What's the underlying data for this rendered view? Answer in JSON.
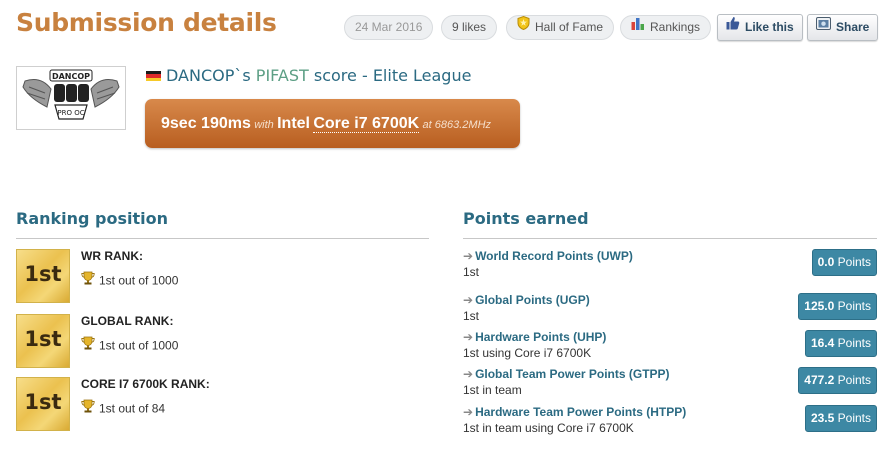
{
  "page": {
    "title": "Submission details"
  },
  "header": {
    "date": "24 Mar 2016",
    "likes": "9 likes",
    "hall_of_fame": "Hall of Fame",
    "rankings": "Rankings",
    "like_this": "Like this",
    "share": "Share"
  },
  "submission": {
    "user": "DANCOP",
    "possessive": "`s ",
    "benchmark": "PIFAST",
    "score_word": " score",
    "league_sep": " - ",
    "league": "Elite League",
    "score_value": "9sec 190ms",
    "with_word": "with",
    "cpu_brand": "Intel",
    "cpu_model": "Core i7 6700K",
    "at_clock": "at 6863.2MHz",
    "logo_text_top": "DANCOP",
    "logo_text_bottom": "PRO OC"
  },
  "ranking": {
    "title": "Ranking position",
    "items": [
      {
        "badge": "1st",
        "label": "WR RANK:",
        "value": "1st out of 1000"
      },
      {
        "badge": "1st",
        "label": "GLOBAL RANK:",
        "value": "1st out of 1000"
      },
      {
        "badge": "1st",
        "label": "CORE I7 6700K RANK:",
        "value": "1st out of 84"
      }
    ]
  },
  "points": {
    "title": "Points earned",
    "unit": "Points",
    "items": [
      {
        "label": "World Record Points (UWP)",
        "sub": "1st",
        "value": "0.0"
      },
      {
        "label": "Global Points (UGP)",
        "sub": "1st",
        "value": "125.0"
      },
      {
        "label": "Hardware Points (UHP)",
        "sub": "1st using Core i7 6700K",
        "value": "16.4"
      },
      {
        "label": "Global Team Power Points (GTPP)",
        "sub": "1st in team",
        "value": "477.2"
      },
      {
        "label": "Hardware Team Power Points (HTPP)",
        "sub": "1st in team using Core i7 6700K",
        "value": "23.5"
      }
    ]
  },
  "colors": {
    "title": "#c8813f",
    "link": "#2b6a82",
    "badge": "#3d88a4",
    "score_box": "#c86f2d"
  }
}
